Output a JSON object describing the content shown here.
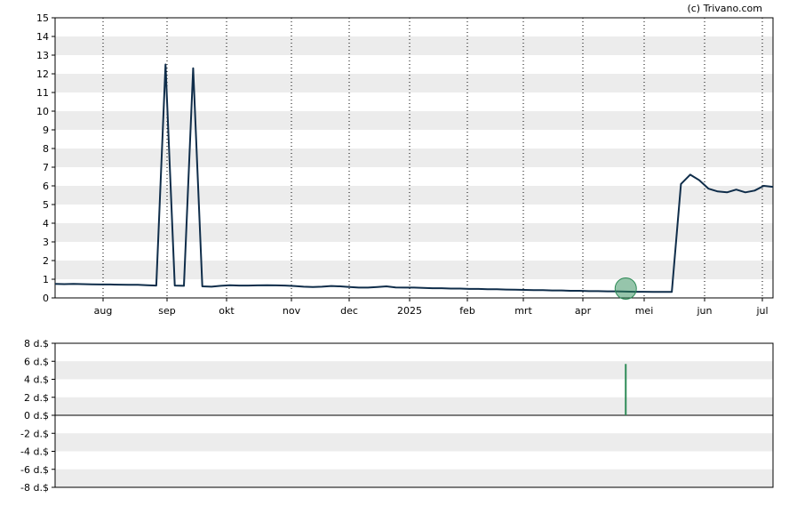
{
  "watermark": "(c) Trivano.com",
  "chart_data": [
    {
      "type": "line",
      "x_tick_labels": [
        "aug",
        "sep",
        "okt",
        "nov",
        "dec",
        "2025",
        "feb",
        "mrt",
        "apr",
        "mei",
        "jun",
        "jul"
      ],
      "y_tick_labels": [
        "0",
        "1",
        "2",
        "3",
        "4",
        "5",
        "6",
        "7",
        "8",
        "9",
        "10",
        "11",
        "12",
        "13",
        "14",
        "15"
      ],
      "ylim": [
        0,
        15
      ],
      "grid": true,
      "series": [
        {
          "color": "#0f2d4a",
          "values": [
            0.75,
            0.74,
            0.75,
            0.74,
            0.73,
            0.72,
            0.72,
            0.71,
            0.7,
            0.7,
            0.68,
            0.66,
            12.5,
            0.66,
            0.65,
            12.3,
            0.62,
            0.6,
            0.65,
            0.68,
            0.66,
            0.66,
            0.67,
            0.68,
            0.67,
            0.66,
            0.64,
            0.6,
            0.58,
            0.6,
            0.64,
            0.62,
            0.58,
            0.55,
            0.55,
            0.58,
            0.62,
            0.56,
            0.55,
            0.55,
            0.54,
            0.52,
            0.52,
            0.5,
            0.5,
            0.48,
            0.48,
            0.46,
            0.46,
            0.45,
            0.44,
            0.43,
            0.42,
            0.42,
            0.4,
            0.4,
            0.38,
            0.38,
            0.36,
            0.36,
            0.35,
            0.35,
            0.34,
            0.33,
            0.33,
            0.32,
            0.32,
            0.32,
            6.1,
            6.6,
            6.3,
            5.85,
            5.7,
            5.65,
            5.8,
            5.65,
            5.75,
            6.0,
            5.95
          ]
        }
      ],
      "markers": [
        {
          "x_index": 62,
          "y": 0.5,
          "color": "#2e8b57"
        }
      ]
    },
    {
      "type": "bar",
      "y_tick_labels": [
        "8 d.$",
        "6 d.$",
        "4 d.$",
        "2 d.$",
        "0 d.$",
        "-2 d.$",
        "-4 d.$",
        "-6 d.$",
        "-8 d.$"
      ],
      "ylim": [
        -8,
        8
      ],
      "grid": true,
      "bars": [
        {
          "x_index": 62,
          "value": 5.7,
          "color": "#2e8b57"
        }
      ]
    }
  ]
}
